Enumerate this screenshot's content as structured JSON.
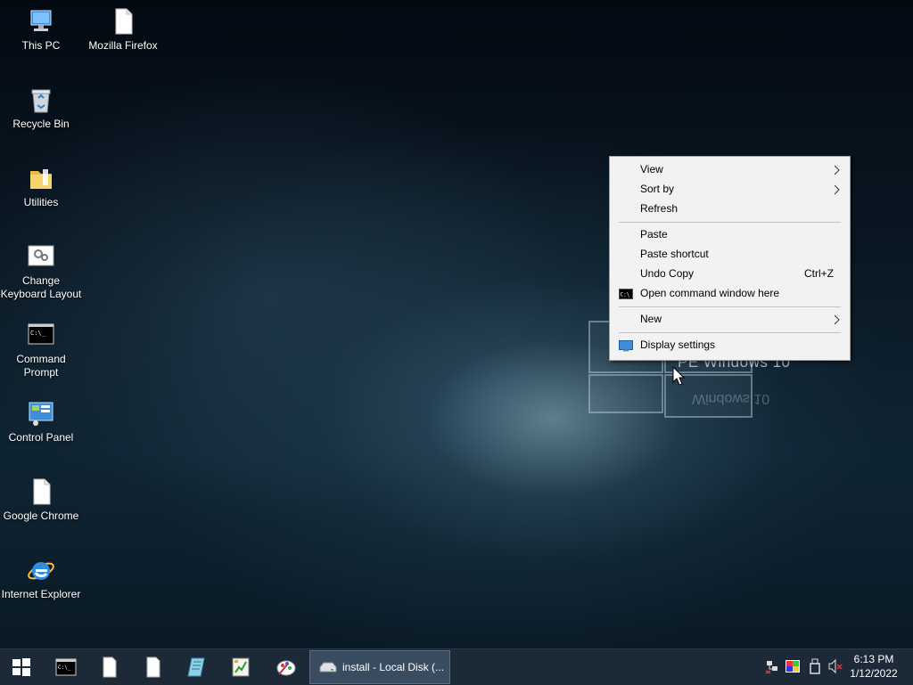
{
  "desktop": {
    "wallpaper_text": "PE Windows 10",
    "icons": [
      {
        "label": "This PC",
        "icon": "computer-icon"
      },
      {
        "label": "Mozilla Firefox",
        "icon": "blank-file-icon"
      },
      {
        "label": "Recycle Bin",
        "icon": "recycle-bin-icon"
      },
      {
        "label": "Utilities",
        "icon": "folder-icon"
      },
      {
        "label": "Change Keyboard Layout",
        "icon": "keyboard-settings-icon"
      },
      {
        "label": "Command Prompt",
        "icon": "command-prompt-icon"
      },
      {
        "label": "Control Panel",
        "icon": "control-panel-icon"
      },
      {
        "label": "Google Chrome",
        "icon": "blank-file-icon"
      },
      {
        "label": "Internet Explorer",
        "icon": "internet-explorer-icon"
      }
    ]
  },
  "context_menu": {
    "view": "View",
    "sort_by": "Sort by",
    "refresh": "Refresh",
    "paste": "Paste",
    "paste_shortcut": "Paste shortcut",
    "undo_copy": "Undo Copy",
    "undo_copy_shortcut": "Ctrl+Z",
    "open_cmd": "Open command window here",
    "new": "New",
    "display_settings": "Display settings"
  },
  "taskbar": {
    "pinned": [
      "windows-start-icon",
      "command-prompt-icon",
      "blank-file-icon",
      "blank-file-icon",
      "notepad-icon",
      "spreadsheet-icon",
      "paint-icon"
    ],
    "active_task": "install - Local Disk (...",
    "tray": [
      "network-icon",
      "color-icon",
      "usb-icon",
      "volume-muted-icon"
    ],
    "time": "6:13 PM",
    "date": "1/12/2022"
  },
  "colors": {
    "taskbar": "#1c2a38",
    "menu_bg": "#f2f2f2",
    "active_task": "#3a4d60"
  }
}
